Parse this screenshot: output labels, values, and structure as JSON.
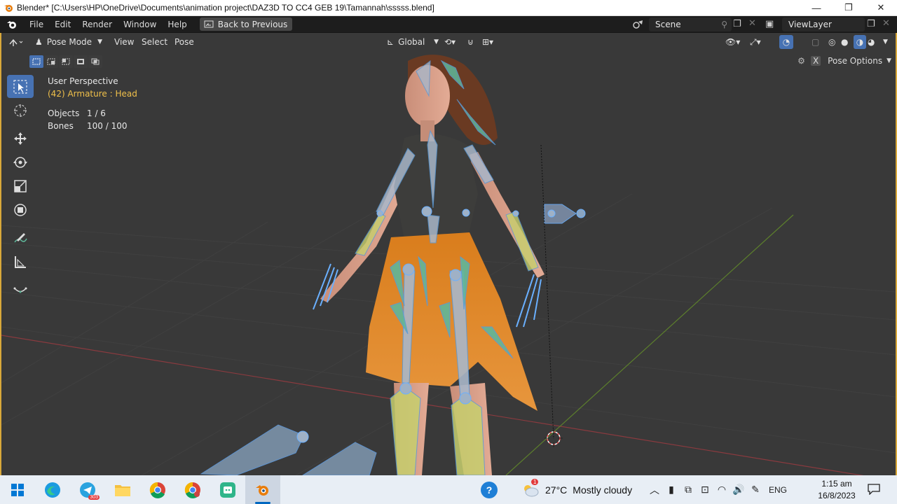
{
  "window": {
    "title": "Blender* [C:\\Users\\HP\\OneDrive\\Documents\\animation project\\DAZ3D TO CC4 GEB 19\\Tamannah\\sssss.blend]",
    "minimize": "—",
    "maximize": "❐",
    "close": "✕"
  },
  "menu": {
    "items": [
      "File",
      "Edit",
      "Render",
      "Window",
      "Help"
    ],
    "back_to_previous": "Back to Previous",
    "scene_label": "Scene",
    "view_layer_label": "ViewLayer"
  },
  "viewport_header": {
    "mode": "Pose Mode",
    "menus": [
      "View",
      "Select",
      "Pose"
    ],
    "transform_orientation": "Global",
    "pose_options": "Pose Options"
  },
  "overlay": {
    "perspective": "User Perspective",
    "selection": "(42) Armature : Head",
    "objects_label": "Objects",
    "objects_value": "1 / 6",
    "bones_label": "Bones",
    "bones_value": "100 / 100"
  },
  "taskbar": {
    "weather_temp": "27°C",
    "weather_desc": "Mostly cloudy",
    "language": "ENG",
    "time": "1:15 am",
    "date": "16/8/2023",
    "telegram_badge": "303",
    "weather_badge": "1"
  },
  "colors": {
    "viewport_bg": "#393939",
    "accent_blue": "#4772b3",
    "selection_yellow": "#f0c04a",
    "active_outline": "#d9a83a",
    "bone_blue": "#a9c4df",
    "bone_green": "#5fb79a",
    "skirt_orange": "#e08a2e"
  }
}
